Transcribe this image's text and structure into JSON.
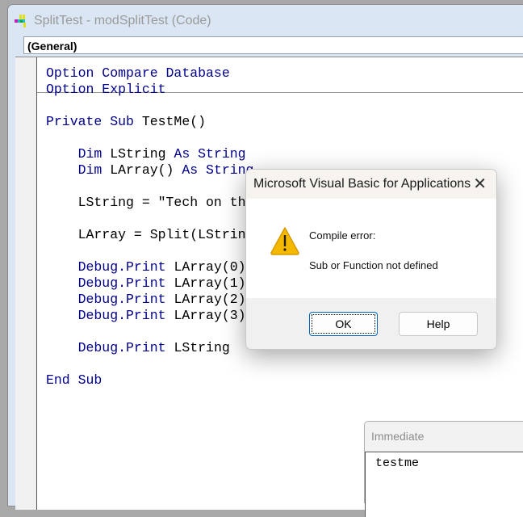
{
  "window": {
    "title": "SplitTest - modSplitTest (Code)",
    "icon": "vba-module-icon",
    "object_combo": "(General)"
  },
  "code": [
    {
      "row": 0,
      "parts": [
        {
          "t": "Option Compare Database",
          "kw": true
        }
      ]
    },
    {
      "row": 1,
      "parts": [
        {
          "t": "Option Explicit",
          "kw": true
        }
      ]
    },
    {
      "row": 3,
      "parts": [
        {
          "t": "Private Sub ",
          "kw": true
        },
        {
          "t": "TestMe()",
          "kw": false
        }
      ]
    },
    {
      "row": 5,
      "parts": [
        {
          "t": "    Dim ",
          "kw": true
        },
        {
          "t": "LString ",
          "kw": false
        },
        {
          "t": "As String",
          "kw": true
        }
      ]
    },
    {
      "row": 6,
      "parts": [
        {
          "t": "    Dim ",
          "kw": true
        },
        {
          "t": "LArray() ",
          "kw": false
        },
        {
          "t": "As String",
          "kw": true
        }
      ]
    },
    {
      "row": 8,
      "parts": [
        {
          "t": "    LString = \"Tech on th",
          "kw": false
        }
      ]
    },
    {
      "row": 10,
      "parts": [
        {
          "t": "    LArray = Split(LStrin",
          "kw": false
        }
      ]
    },
    {
      "row": 12,
      "parts": [
        {
          "t": "    Debug.Print ",
          "kw": true
        },
        {
          "t": "LArray(0)",
          "kw": false
        }
      ]
    },
    {
      "row": 13,
      "parts": [
        {
          "t": "    Debug.Print ",
          "kw": true
        },
        {
          "t": "LArray(1)",
          "kw": false
        }
      ]
    },
    {
      "row": 14,
      "parts": [
        {
          "t": "    Debug.Print ",
          "kw": true
        },
        {
          "t": "LArray(2)",
          "kw": false
        }
      ]
    },
    {
      "row": 15,
      "parts": [
        {
          "t": "    Debug.Print ",
          "kw": true
        },
        {
          "t": "LArray(3)",
          "kw": false
        }
      ]
    },
    {
      "row": 17,
      "parts": [
        {
          "t": "    Debug.Print ",
          "kw": true
        },
        {
          "t": "LString",
          "kw": false
        }
      ]
    },
    {
      "row": 19,
      "parts": [
        {
          "t": "End Sub",
          "kw": true
        }
      ]
    }
  ],
  "dialog": {
    "title": "Microsoft Visual Basic for Applications",
    "icon": "warning-icon",
    "message_title": "Compile error:",
    "message": "Sub or Function not defined",
    "ok_label": "OK",
    "help_label": "Help"
  },
  "immediate": {
    "title": "Immediate",
    "content": "testme"
  },
  "colors": {
    "keyword": "#00008b",
    "accent": "#0067c0",
    "warning": "#f5b800"
  }
}
